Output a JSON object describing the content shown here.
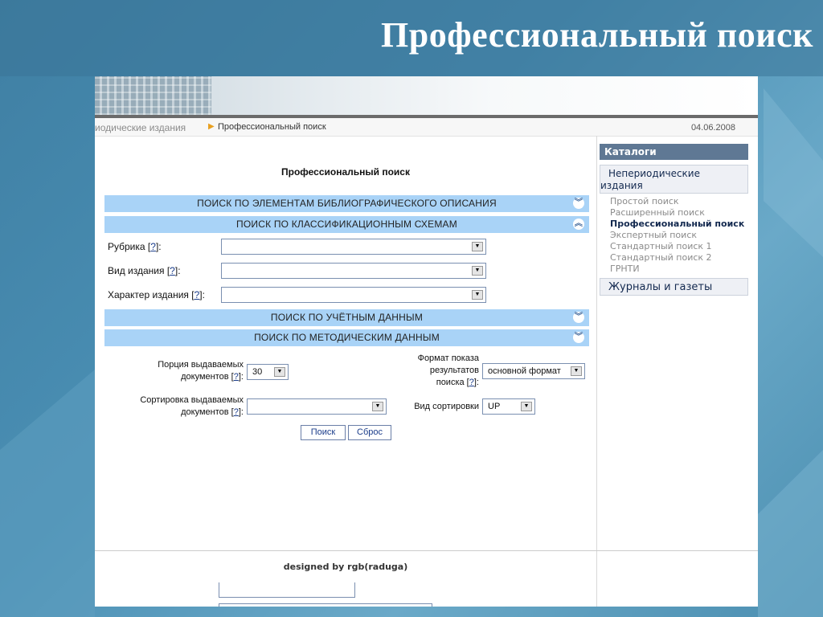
{
  "slide_title": "Профессиональный поиск",
  "breadcrumb": {
    "parent": "иодические издания",
    "current": "Профессиональный поиск",
    "date": "04.06.2008"
  },
  "main": {
    "title": "Профессиональный поиск",
    "sections": [
      {
        "label": "ПОИСК ПО ЭЛЕМЕНТАМ БИБЛИОГРАФИЧЕСКОГО ОПИСАНИЯ",
        "state": "collapsed"
      },
      {
        "label": "ПОИСК ПО КЛАССИФИКАЦИОННЫМ СХЕМАМ",
        "state": "expanded"
      },
      {
        "label": "ПОИСК ПО УЧЁТНЫМ ДАННЫМ",
        "state": "collapsed"
      },
      {
        "label": "ПОИСК ПО МЕТОДИЧЕСКИМ ДАННЫМ",
        "state": "collapsed"
      }
    ],
    "fields": {
      "rubrika": {
        "label": "Рубрика",
        "help": "?",
        "value": ""
      },
      "vid": {
        "label": "Вид издания",
        "help": "?",
        "value": ""
      },
      "harakter": {
        "label": "Характер издания",
        "help": "?",
        "value": ""
      }
    },
    "options": {
      "portion_label_1": "Порция выдаваемых",
      "portion_label_2": "документов",
      "portion_value": "30",
      "format_label_1": "Формат показа",
      "format_label_2": "результатов",
      "format_label_3": "поиска",
      "format_value": "основной формат",
      "sort_label_1": "Сортировка выдаваемых",
      "sort_label_2": "документов",
      "sort_value": "",
      "sort_kind_label": "Вид сортировки",
      "sort_kind_value": "UP",
      "help": "?"
    },
    "buttons": {
      "search": "Поиск",
      "reset": "Сброс"
    },
    "footer": "designed by rgb(raduga)"
  },
  "sidebar": {
    "header": "Каталоги",
    "group1": "Непериодические издания",
    "items": [
      {
        "label": "Простой поиск",
        "active": false
      },
      {
        "label": "Расширенный поиск",
        "active": false
      },
      {
        "label": "Профессиональный поиск",
        "active": true
      },
      {
        "label": "Экспертный поиск",
        "active": false
      },
      {
        "label": "Стандартный поиск 1",
        "active": false
      },
      {
        "label": "Стандартный поиск 2",
        "active": false
      },
      {
        "label": "ГРНТИ",
        "active": false
      }
    ],
    "group2": "Журналы и газеты"
  },
  "colors": {
    "section_bar": "#a9d3f7",
    "sidebar_header": "#5f7894",
    "link": "#1a3c8a"
  }
}
